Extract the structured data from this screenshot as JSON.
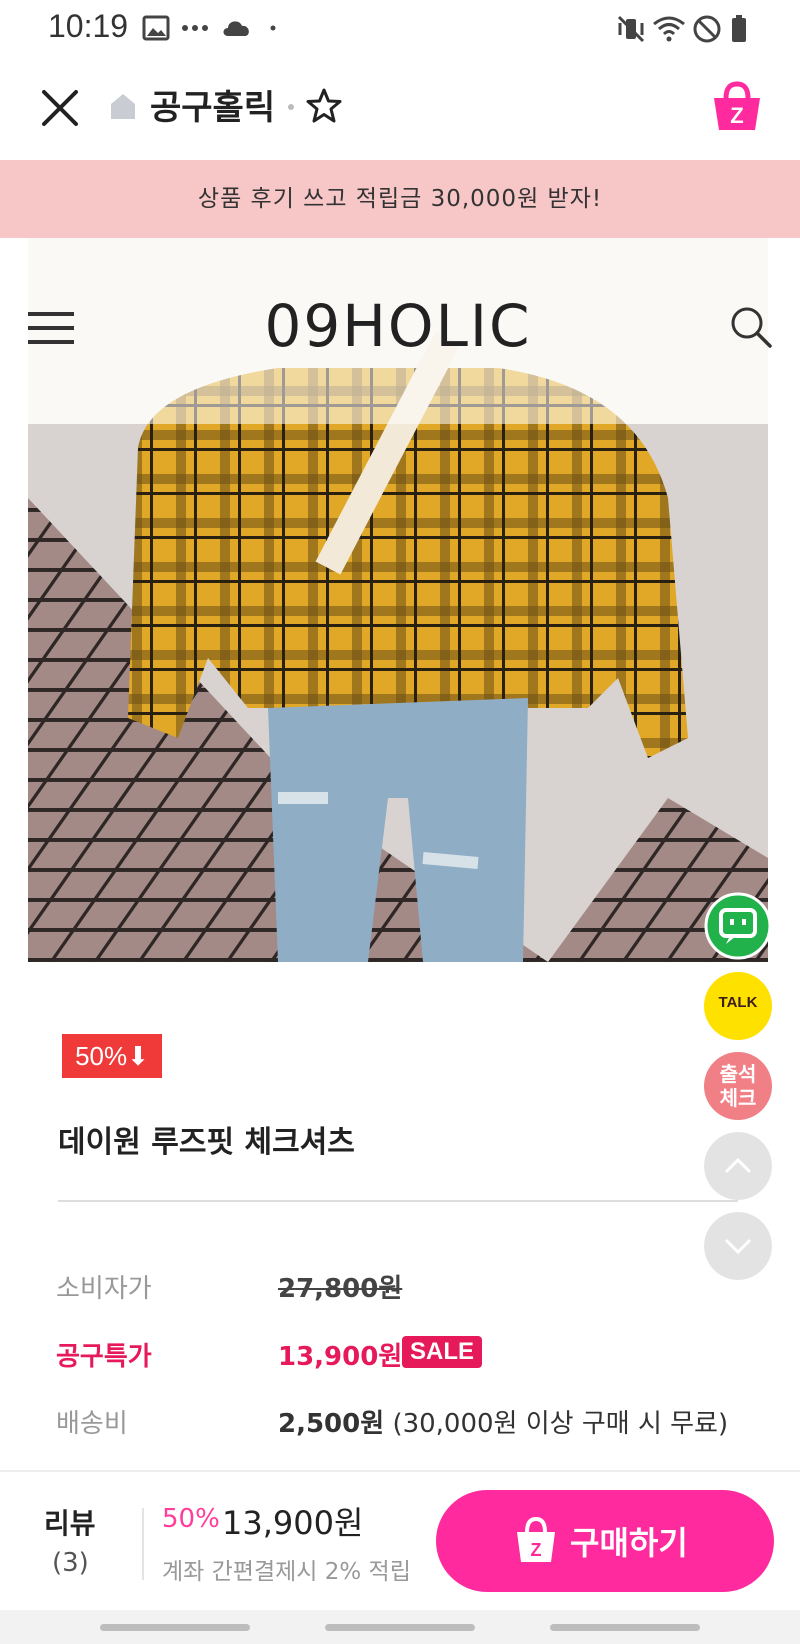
{
  "status_bar": {
    "time": "10:19",
    "icons": [
      "image-icon",
      "more-dots-icon",
      "cloud-icon",
      "dot-icon",
      "mute-vibrate-icon",
      "wifi-icon",
      "do-not-disturb-icon",
      "battery-icon"
    ]
  },
  "header": {
    "store_name": "공구홀릭",
    "close_icon": "close-icon",
    "favorite_icon": "star-icon",
    "cart_icon": "cart-icon"
  },
  "banner": {
    "text": "상품 후기 쓰고 적립금 30,000원 받자!"
  },
  "shop": {
    "brand": "09HOLIC"
  },
  "product": {
    "discount_badge": "50%⬇",
    "title": "데이원 루즈핏 체크셔츠",
    "consumer_price_label": "소비자가",
    "consumer_price": "27,800원",
    "group_price_label": "공구특가",
    "group_price": "13,900원",
    "sale_tag": "SALE",
    "shipping_label": "배송비",
    "shipping_value": "2,500원",
    "shipping_note": "(30,000원 이상 구매 시 무료)"
  },
  "floating": {
    "talk_label": "TALK",
    "attendance_label": "출석\n체크"
  },
  "bottom_bar": {
    "review_label": "리뷰",
    "review_count": "(3)",
    "discount_pct": "50%",
    "price": "13,900원",
    "note": "계좌 간편결제시 2% 적립",
    "buy_label": "구매하기"
  },
  "colors": {
    "accent_pink": "#ff2a9d",
    "sale_red": "#e6195a",
    "banner_bg": "#f7c6c6",
    "badge_red": "#f03a3a"
  }
}
